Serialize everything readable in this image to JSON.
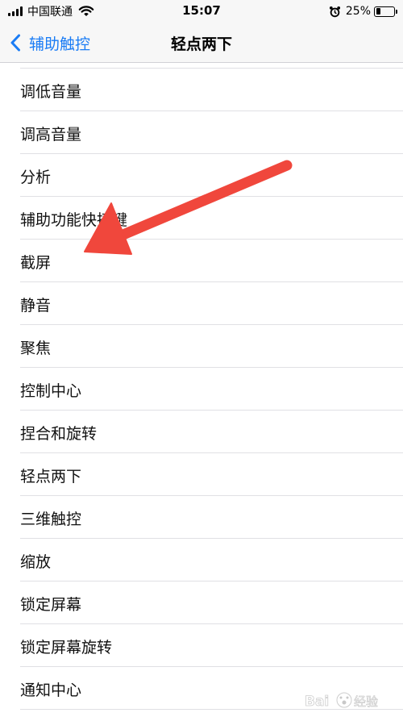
{
  "status_bar": {
    "carrier": "中国联通",
    "time": "15:07",
    "battery": "25%",
    "battery_level": 0.25
  },
  "nav": {
    "back_label": "辅助触控",
    "title": "轻点两下"
  },
  "list": {
    "items": [
      {
        "label": "调低音量"
      },
      {
        "label": "调高音量"
      },
      {
        "label": "分析"
      },
      {
        "label": "辅助功能快捷键"
      },
      {
        "label": "截屏"
      },
      {
        "label": "静音"
      },
      {
        "label": "聚焦"
      },
      {
        "label": "控制中心"
      },
      {
        "label": "捏合和旋转"
      },
      {
        "label": "轻点两下"
      },
      {
        "label": "三维触控"
      },
      {
        "label": "缩放"
      },
      {
        "label": "锁定屏幕"
      },
      {
        "label": "锁定屏幕旋转"
      },
      {
        "label": "通知中心"
      }
    ]
  },
  "annotation": {
    "color": "#f0473c",
    "points_to": "截屏"
  },
  "watermark": {
    "text": "Bai经验"
  },
  "colors": {
    "accent": "#1a7cf5",
    "separator": "#e0e0e4"
  }
}
